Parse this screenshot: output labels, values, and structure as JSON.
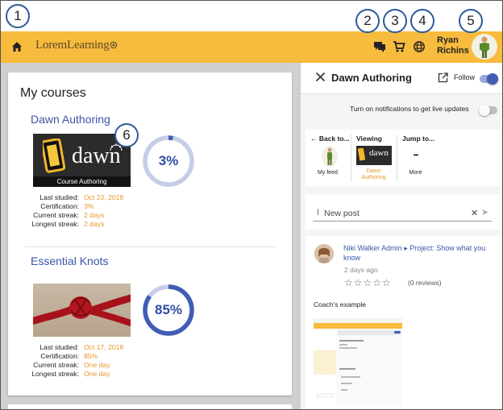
{
  "callouts": [
    "1",
    "2",
    "3",
    "4",
    "5",
    "6"
  ],
  "topbar": {
    "brand": "LoremLearning",
    "user_first": "Ryan",
    "user_last": "Richins",
    "accent_color": "#f7bb3d",
    "icons": [
      "home-icon",
      "chat-icon",
      "cart-icon",
      "globe-icon"
    ]
  },
  "courses": {
    "title": "My courses",
    "items": [
      {
        "name": "Dawn Authoring",
        "thumb_word": "dawn",
        "thumb_caption": "Course Authoring",
        "progress_label": "3%",
        "progress": 0.03,
        "stats": [
          {
            "key": "Last studied:",
            "value": "Oct 23, 2018"
          },
          {
            "key": "Certification:",
            "value": "3%"
          },
          {
            "key": "Current streak:",
            "value": "2 days"
          },
          {
            "key": "Longest streak:",
            "value": "2 days"
          }
        ]
      },
      {
        "name": "Essential Knots",
        "progress_label": "85%",
        "progress": 0.85,
        "stats": [
          {
            "key": "Last studied:",
            "value": "Oct 17, 2018"
          },
          {
            "key": "Certification:",
            "value": "85%"
          },
          {
            "key": "Current streak:",
            "value": "One day"
          },
          {
            "key": "Longest streak:",
            "value": "One day"
          }
        ]
      }
    ]
  },
  "panel": {
    "title": "Dawn Authoring",
    "follow_label": "Follow",
    "follow_on": true,
    "notif_text": "Turn on notifications to get live updates",
    "notif_on": false,
    "nav": {
      "back_head": "Back to...",
      "back_label": "My feed",
      "viewing_head": "Viewing",
      "viewing_thumb_word": "dawn",
      "viewing_label_1": "Dawn",
      "viewing_label_2": "Authoring",
      "jump_head": "Jump to...",
      "jump_dots": "•••",
      "jump_label": "More"
    },
    "post_placeholder": "New post",
    "feed": {
      "author": "Niki Walker Admin",
      "arrow": "▸",
      "project": "Project: Show what you know",
      "time": "2 days ago",
      "stars": "☆☆☆☆☆",
      "reviews": "(0 reviews)",
      "body": "Coach's example"
    }
  },
  "colors": {
    "link": "#3a55a8",
    "stat_value": "#e8982a",
    "toggle_on": "#3f5db5"
  }
}
